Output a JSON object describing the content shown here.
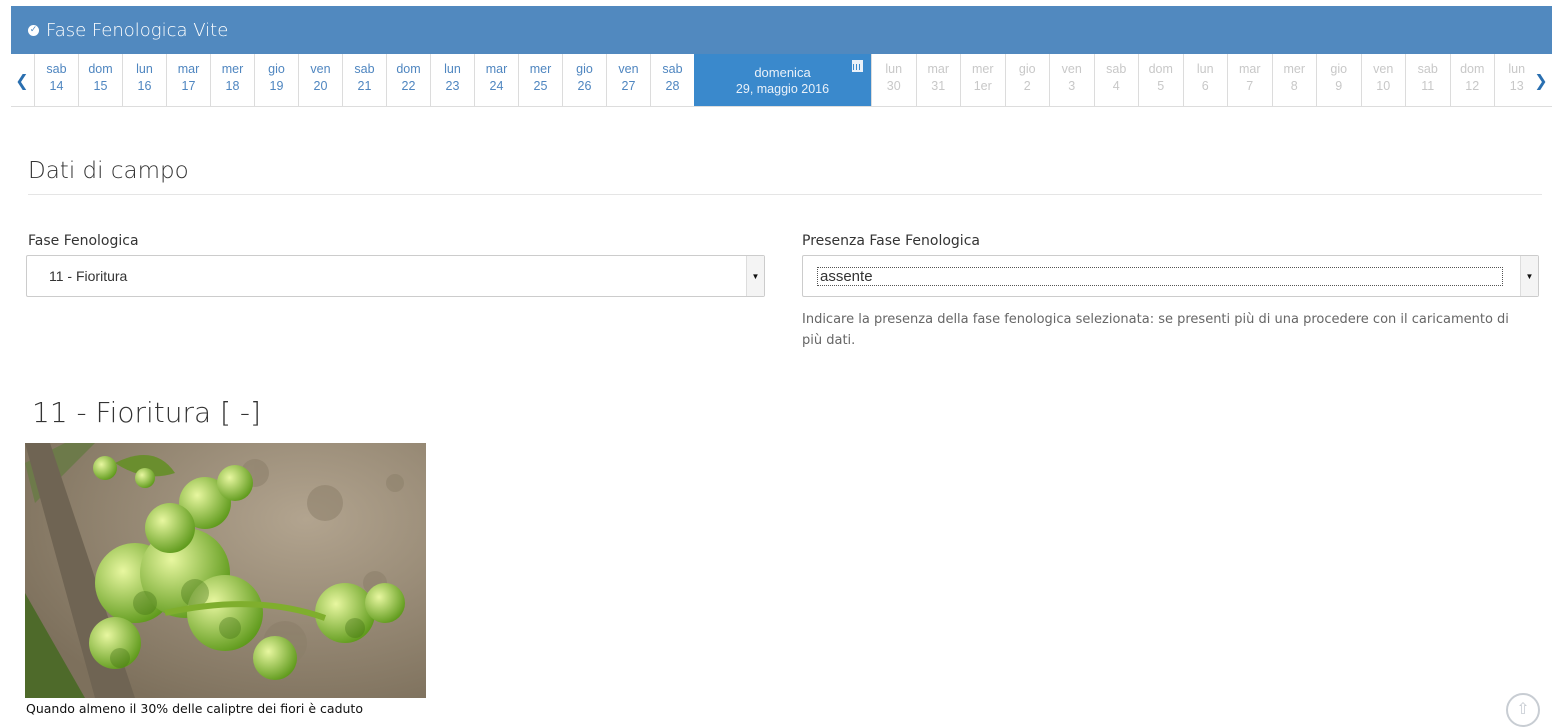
{
  "header": {
    "icon": "globe-icon",
    "title": "Fase Fenologica Vite"
  },
  "calendar": {
    "prev_icon": "chevron-left-icon",
    "next_icon": "chevron-right-icon",
    "past_days": [
      {
        "name": "sab",
        "num": "14"
      },
      {
        "name": "dom",
        "num": "15"
      },
      {
        "name": "lun",
        "num": "16"
      },
      {
        "name": "mar",
        "num": "17"
      },
      {
        "name": "mer",
        "num": "18"
      },
      {
        "name": "gio",
        "num": "19"
      },
      {
        "name": "ven",
        "num": "20"
      },
      {
        "name": "sab",
        "num": "21"
      },
      {
        "name": "dom",
        "num": "22"
      },
      {
        "name": "lun",
        "num": "23"
      },
      {
        "name": "mar",
        "num": "24"
      },
      {
        "name": "mer",
        "num": "25"
      },
      {
        "name": "gio",
        "num": "26"
      },
      {
        "name": "ven",
        "num": "27"
      },
      {
        "name": "sab",
        "num": "28"
      }
    ],
    "selected": {
      "name": "domenica",
      "date": "29, maggio 2016",
      "icon": "calendar-icon"
    },
    "future_days": [
      {
        "name": "lun",
        "num": "30"
      },
      {
        "name": "mar",
        "num": "31"
      },
      {
        "name": "mer",
        "num": "1er"
      },
      {
        "name": "gio",
        "num": "2"
      },
      {
        "name": "ven",
        "num": "3"
      },
      {
        "name": "sab",
        "num": "4"
      },
      {
        "name": "dom",
        "num": "5"
      },
      {
        "name": "lun",
        "num": "6"
      },
      {
        "name": "mar",
        "num": "7"
      },
      {
        "name": "mer",
        "num": "8"
      },
      {
        "name": "gio",
        "num": "9"
      },
      {
        "name": "ven",
        "num": "10"
      },
      {
        "name": "sab",
        "num": "11"
      },
      {
        "name": "dom",
        "num": "12"
      },
      {
        "name": "lun",
        "num": "13"
      }
    ]
  },
  "section_title": "Dati di campo",
  "fase": {
    "label": "Fase Fenologica",
    "value": "11 - Fioritura"
  },
  "presenza": {
    "label": "Presenza Fase Fenologica",
    "value": "assente",
    "help": "Indicare la presenza della fase fenologica selezionata: se presenti più di una procedere con il caricamento di più dati."
  },
  "stage": {
    "title": "11 - Fioritura [ -]",
    "caption": "Quando almeno il 30% delle caliptre dei fiori è caduto"
  },
  "colors": {
    "header_bg": "#5189bf",
    "selected_day_bg": "#3a89cc",
    "link_blue": "#4f86c0"
  }
}
